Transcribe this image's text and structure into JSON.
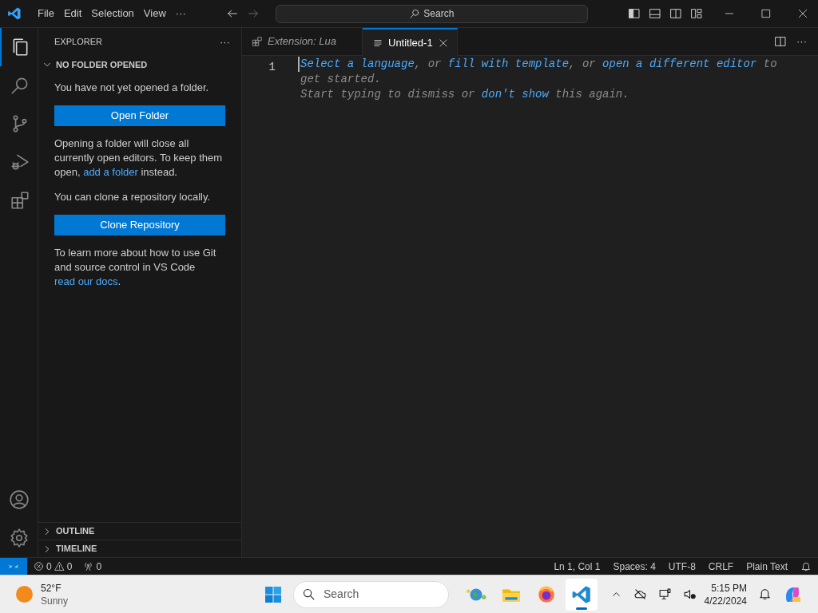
{
  "title_bar": {
    "menu": [
      "File",
      "Edit",
      "Selection",
      "View",
      "···"
    ],
    "search": "Search"
  },
  "activity_bar": [
    {
      "kind": "explorer",
      "selected": true
    },
    {
      "kind": "search",
      "selected": false
    },
    {
      "kind": "source-control",
      "selected": false
    },
    {
      "kind": "run-debug",
      "selected": false
    },
    {
      "kind": "extensions",
      "selected": false
    }
  ],
  "activity_bar_bottom": [
    {
      "kind": "account"
    },
    {
      "kind": "settings"
    }
  ],
  "sidebar": {
    "title": "EXPLORER",
    "more": "···",
    "sections": [
      {
        "title": "NO FOLDER OPENED",
        "expanded": true
      },
      {
        "title": "OUTLINE",
        "expanded": false
      },
      {
        "title": "TIMELINE",
        "expanded": false
      }
    ],
    "content": [
      {
        "kind": "text",
        "parts": [
          {
            "text": "You have not yet opened a folder.",
            "link": false
          }
        ]
      },
      {
        "kind": "button",
        "label": "Open Folder"
      },
      {
        "kind": "text",
        "parts": [
          {
            "text": "Opening a folder will close all currently open editors. To keep them open, ",
            "link": false
          },
          {
            "text": "add a folder",
            "link": true
          },
          {
            "text": " instead.",
            "link": false
          }
        ]
      },
      {
        "kind": "text",
        "parts": [
          {
            "text": "You can clone a repository locally.",
            "link": false
          }
        ]
      },
      {
        "kind": "button",
        "label": "Clone Repository"
      },
      {
        "kind": "text",
        "parts": [
          {
            "text": "To learn more about how to use Git and source control in VS Code ",
            "link": false
          },
          {
            "text": "read our docs",
            "link": true
          },
          {
            "text": ".",
            "link": false
          }
        ]
      }
    ]
  },
  "tabs": [
    {
      "label": "Extension: Lua",
      "kind": "extension",
      "selected": false
    },
    {
      "label": "Untitled-1",
      "kind": "file",
      "selected": true
    }
  ],
  "editor": {
    "line_number": "1",
    "hint_lines": [
      [
        {
          "text": "Select a language",
          "link": true
        },
        {
          "text": ", or ",
          "link": false
        },
        {
          "text": "fill with template",
          "link": true
        },
        {
          "text": ", or ",
          "link": false
        },
        {
          "text": "open a different editor",
          "link": true
        },
        {
          "text": " to",
          "link": false
        }
      ],
      [
        {
          "text": "get started.",
          "link": false
        }
      ],
      [
        {
          "text": "Start typing to dismiss or ",
          "link": false
        },
        {
          "text": "don't show",
          "link": true
        },
        {
          "text": " this again.",
          "link": false
        }
      ]
    ]
  },
  "status_bar": {
    "errors": "0",
    "warnings": "0",
    "ports": "0",
    "right": [
      "Ln 1, Col 1",
      "Spaces: 4",
      "UTF-8",
      "CRLF",
      "Plain Text"
    ]
  },
  "taskbar": {
    "weather": {
      "temperature": "52°F",
      "condition": "Sunny"
    },
    "search": "Search",
    "apps": [
      {
        "kind": "widgets",
        "active": false
      },
      {
        "kind": "files",
        "active": false
      },
      {
        "kind": "browser",
        "active": false
      },
      {
        "kind": "code",
        "active": true
      }
    ],
    "time": "5:15 PM",
    "date": "4/22/2024"
  }
}
